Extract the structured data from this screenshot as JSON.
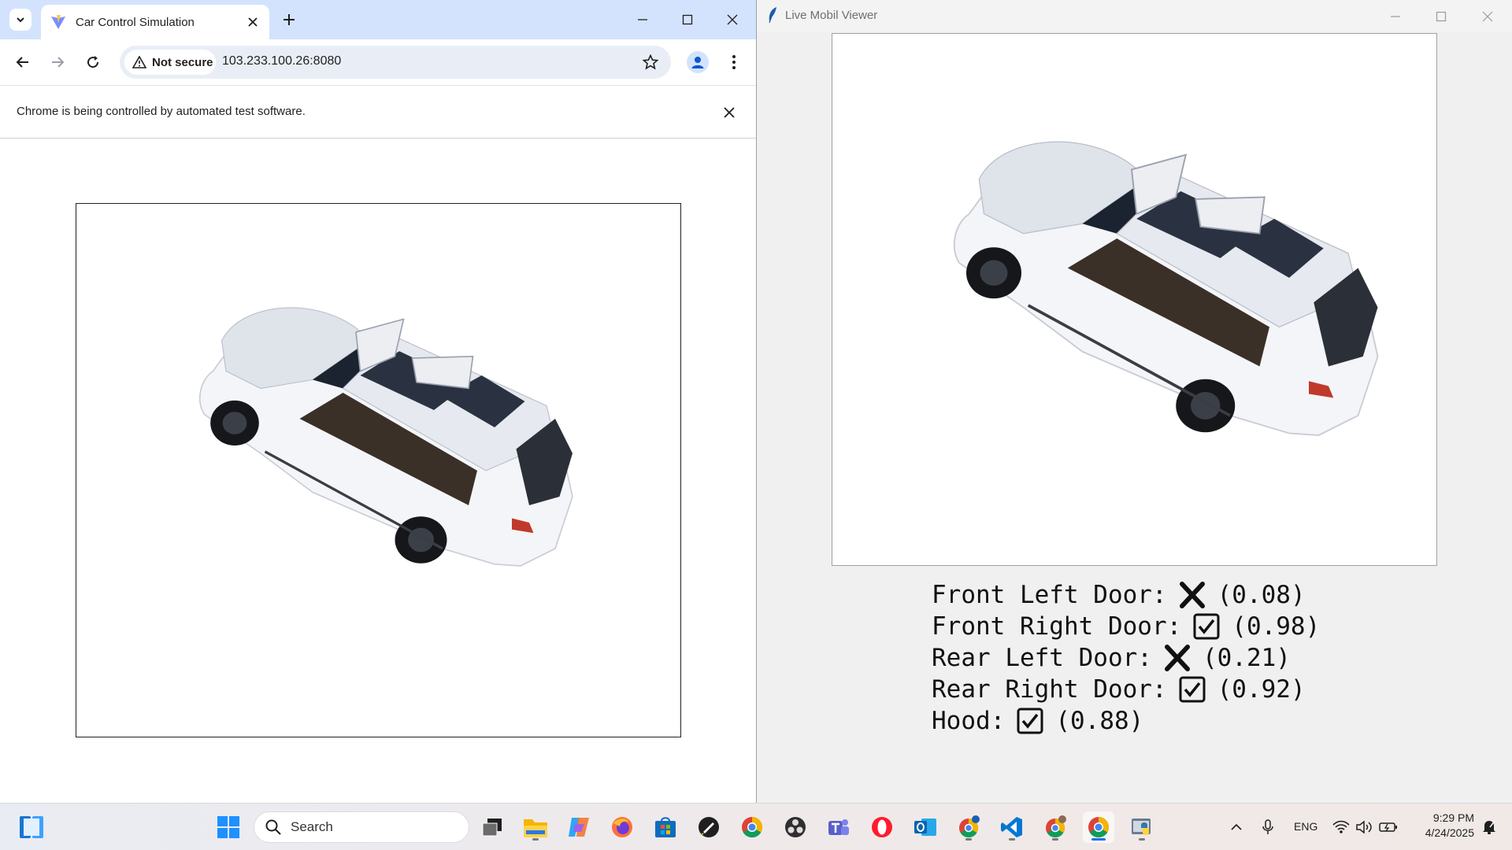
{
  "chrome": {
    "tab_title": "Car Control Simulation",
    "security_label": "Not secure",
    "url": "103.233.100.26:8080",
    "infobar_text": "Chrome is being controlled by automated test software."
  },
  "viewer": {
    "window_title": "Live Mobil Viewer",
    "status": [
      {
        "label": "Front Left Door:",
        "state": "closed",
        "value": "(0.08)"
      },
      {
        "label": "Front Right Door:",
        "state": "open",
        "value": "(0.98)"
      },
      {
        "label": "Rear Left Door:",
        "state": "closed",
        "value": "(0.21)"
      },
      {
        "label": "Rear Right Door:",
        "state": "open",
        "value": "(0.92)"
      },
      {
        "label": "Hood:",
        "state": "open",
        "value": "(0.88)"
      }
    ]
  },
  "taskbar": {
    "search_placeholder": "Search",
    "language": "ENG",
    "time": "9:29 PM",
    "date": "4/24/2025",
    "apps": [
      "widgets-icon",
      "start-icon",
      "task-view-icon",
      "file-explorer-icon",
      "copilot-icon",
      "firefox-icon",
      "microsoft-store-icon",
      "inkscape-icon",
      "chrome-icon",
      "obs-icon",
      "teams-icon",
      "opera-icon",
      "outlook-icon",
      "chrome-profile-icon",
      "vscode-icon",
      "chrome-profile-2-icon",
      "chrome-active-icon",
      "python-icon"
    ]
  },
  "colors": {
    "tabstrip": "#d3e3fd",
    "car_body": "#eef0f4",
    "accent": "#1a73e8"
  }
}
